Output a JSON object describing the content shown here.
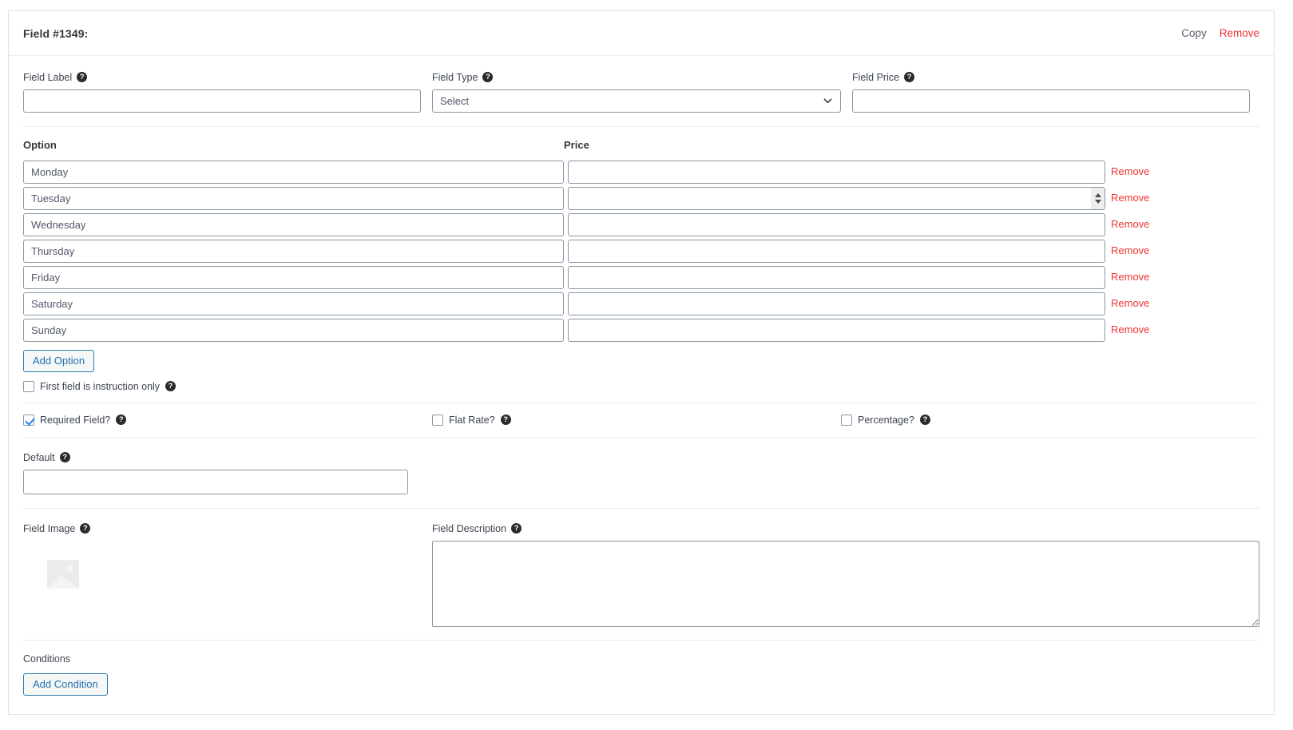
{
  "panel": {
    "title": "Field #1349:",
    "copy_label": "Copy",
    "remove_label": "Remove"
  },
  "basics": {
    "field_label": {
      "label": "Field Label",
      "value": "",
      "placeholder": ""
    },
    "field_type": {
      "label": "Field Type",
      "value": "Select"
    },
    "field_price": {
      "label": "Field Price",
      "value": "",
      "placeholder": ""
    }
  },
  "options": {
    "header_option": "Option",
    "header_price": "Price",
    "remove_label": "Remove",
    "rows": [
      {
        "option": "Monday",
        "price": "",
        "spinner": false
      },
      {
        "option": "Tuesday",
        "price": "",
        "spinner": true
      },
      {
        "option": "Wednesday",
        "price": "",
        "spinner": false
      },
      {
        "option": "Thursday",
        "price": "",
        "spinner": false
      },
      {
        "option": "Friday",
        "price": "",
        "spinner": false
      },
      {
        "option": "Saturday",
        "price": "",
        "spinner": false
      },
      {
        "option": "Sunday",
        "price": "",
        "spinner": false
      }
    ],
    "add_option_label": "Add Option",
    "first_field_instruction_label": "First field is instruction only",
    "first_field_instruction_checked": false
  },
  "toggles": {
    "required_field": {
      "label": "Required Field?",
      "checked": true
    },
    "flat_rate": {
      "label": "Flat Rate?",
      "checked": false
    },
    "percentage": {
      "label": "Percentage?",
      "checked": false
    }
  },
  "default_field": {
    "label": "Default",
    "value": "",
    "placeholder": ""
  },
  "media": {
    "field_image_label": "Field Image",
    "field_description_label": "Field Description",
    "field_description_value": "",
    "field_description_placeholder": ""
  },
  "conditions": {
    "label": "Conditions",
    "add_condition_label": "Add Condition"
  },
  "icons": {
    "help": "?",
    "chevron_down": "chevron-down-icon",
    "image_placeholder": "image-placeholder-icon"
  },
  "colors": {
    "danger": "#f03333",
    "link": "#2271b1",
    "accent_check": "#1d86e8",
    "border": "#8c96a3"
  }
}
